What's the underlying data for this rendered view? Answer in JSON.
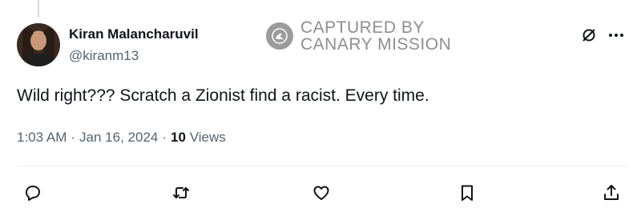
{
  "author": {
    "display_name": "Kiran Malancharuvil",
    "handle": "@kiranm13"
  },
  "watermark": {
    "line1": "CAPTURED BY",
    "line2": "CANARY MISSION"
  },
  "tweet": {
    "text": "Wild right??? Scratch a Zionist find a racist. Every time.",
    "time": "1:03 AM",
    "separator1": "·",
    "date": "Jan 16, 2024",
    "separator2": "·",
    "views_count": "10",
    "views_label": "Views"
  },
  "icons": {
    "header": [
      "grok-icon",
      "more-icon"
    ],
    "actions": [
      "reply-icon",
      "retweet-icon",
      "like-icon",
      "bookmark-icon",
      "share-icon"
    ]
  },
  "colors": {
    "text_primary": "#0f1419",
    "text_secondary": "#536471",
    "divider": "#eff3f4",
    "watermark": "#8e8e8e"
  }
}
